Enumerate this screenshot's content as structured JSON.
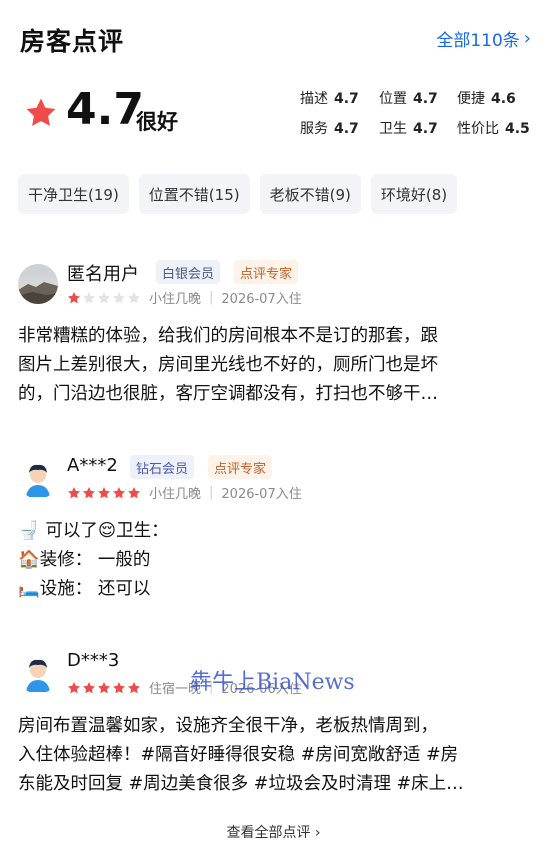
{
  "header": {
    "title": "房客点评",
    "all_label": "全部110条"
  },
  "rating": {
    "score": "4.7",
    "word": "很好",
    "subs": [
      {
        "label": "描述",
        "value": "4.7"
      },
      {
        "label": "位置",
        "value": "4.7"
      },
      {
        "label": "便捷",
        "value": "4.6"
      },
      {
        "label": "服务",
        "value": "4.7"
      },
      {
        "label": "卫生",
        "value": "4.7"
      },
      {
        "label": "性价比",
        "value": "4.5"
      }
    ],
    "star_color": "#f04b4b"
  },
  "tags": [
    "干净卫生(19)",
    "位置不错(15)",
    "老板不错(9)",
    "环境好(8)"
  ],
  "reviews": [
    {
      "user": "匿名用户",
      "level": "白银会员",
      "expert": "点评专家",
      "rating": 1,
      "stay": "小住几晚",
      "date": "2026-07入住",
      "lines": [
        "非常糟糕的体验，给我们的房间根本不是订的那套，跟",
        "图片上差别很大，房间里光线也不好的，厕所门也是坏",
        "的，门沿边也很脏，客厅空调都没有，打扫也不够干…"
      ]
    },
    {
      "user": "A***2",
      "level": "钻石会员",
      "expert": "点评专家",
      "rating": 5,
      "stay": "小住几晚",
      "date": "2026-07入住",
      "lines": [
        "🚽 可以了😌卫生：",
        "🏠装修： 一般的",
        "🛏️设施： 还可以"
      ]
    },
    {
      "user": "D***3",
      "rating": 5,
      "stay": "住宿一晚",
      "date": "2026-06入住",
      "lines": [
        "房间布置温馨如家，设施齐全很干净，老板热情周到，",
        "入住体验超棒！#隔音好睡得很安稳 #房间宽敞舒适 #房",
        "东能及时回复 #周边美食很多 #垃圾会及时清理 #床上…"
      ]
    }
  ],
  "watermark": "犇牛上BiaNews",
  "footer": {
    "view_all": "查看全部点评"
  }
}
